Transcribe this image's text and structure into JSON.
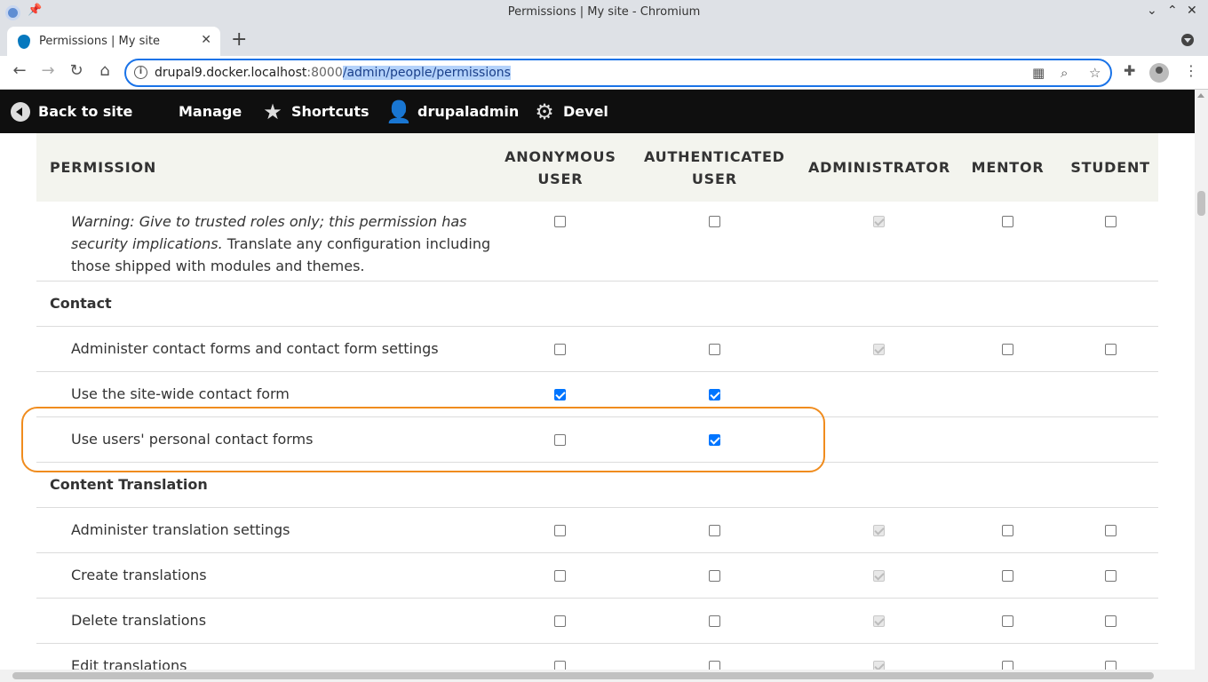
{
  "window": {
    "title": "Permissions | My site - Chromium",
    "controls": [
      "⌄",
      "⌃",
      "◇",
      "✕"
    ]
  },
  "tab": {
    "title": "Permissions | My site",
    "close": "✕",
    "new_tab": "+"
  },
  "toolbar": {
    "url_host": "drupal9.docker.localhost",
    "url_port": ":8000",
    "url_path": "/admin/people/permissions",
    "back": "←",
    "forward": "→",
    "reload": "↻",
    "home": "⌂"
  },
  "admin_bar": {
    "back_to_site": "Back to site",
    "manage": "Manage",
    "shortcuts": "Shortcuts",
    "user": "drupaladmin",
    "devel": "Devel"
  },
  "table": {
    "headers": {
      "permission": "PERMISSION",
      "anonymous_1": "ANONYMOUS",
      "anonymous_2": "USER",
      "authenticated_1": "AUTHENTICATED",
      "authenticated_2": "USER",
      "administrator": "ADMINISTRATOR",
      "mentor": "MENTOR",
      "student": "STUDENT"
    },
    "warning_row": {
      "warning": "Warning: Give to trusted roles only; this permission has security implications.",
      "text": " Translate any configuration including those shipped with modules and themes."
    },
    "modules": {
      "contact": "Contact",
      "content_translation": "Content Translation"
    },
    "rows": {
      "administer_contact": "Administer contact forms and contact form settings",
      "site_wide_contact": "Use the site-wide contact form",
      "personal_contact": "Use users' personal contact forms",
      "administer_translation": "Administer translation settings",
      "create_translations": "Create translations",
      "delete_translations": "Delete translations",
      "edit_translations": "Edit translations"
    }
  },
  "colors": {
    "accent": "#1a73e8",
    "checkbox_checked": "#0075ff",
    "highlight": "#f08c1e",
    "admin_bar": "#0f0f0f"
  }
}
